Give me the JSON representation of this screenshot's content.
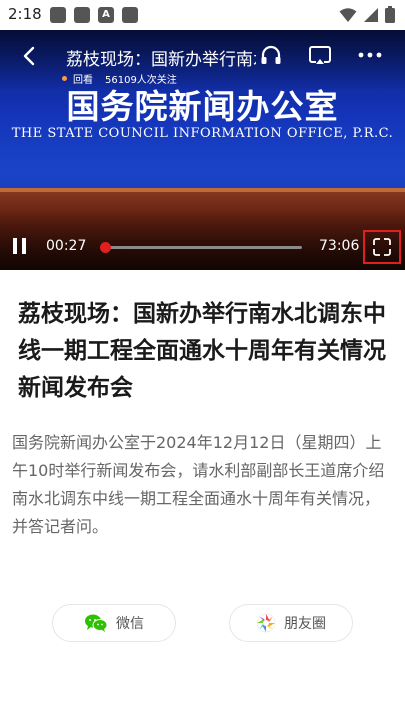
{
  "status_bar": {
    "time": "2:18",
    "app_icon_letter": "A"
  },
  "video": {
    "title": "荔枝现场：国新办举行南水北调东中线一期工程全面通水十周年有关情况新闻发布会",
    "replay_label": "回看",
    "followers": "56109人次关注",
    "backdrop_cn": "国务院新闻办公室",
    "backdrop_en": "THE STATE COUNCIL INFORMATION OFFICE, P.R.C.",
    "time_current": "00:27",
    "time_total": "73:06",
    "progress": 0.006,
    "icons": {
      "back": "back-arrow-icon",
      "audio": "headphones-icon",
      "cast": "cast-icon",
      "more": "more-icon",
      "pause": "pause-icon",
      "fullscreen": "fullscreen-icon"
    }
  },
  "article": {
    "headline": "荔枝现场：国新办举行南水北调东中线一期工程全面通水十周年有关情况新闻发布会",
    "summary": "国务院新闻办公室于2024年12月12日（星期四）上午10时举行新闻发布会，请水利部副部长王道席介绍南水北调东中线一期工程全面通水十周年有关情况，并答记者问。"
  },
  "share": {
    "wechat_label": "微信",
    "moments_label": "朋友圈"
  },
  "colors": {
    "accent_red": "#e02020",
    "wechat_green": "#2dc100"
  }
}
